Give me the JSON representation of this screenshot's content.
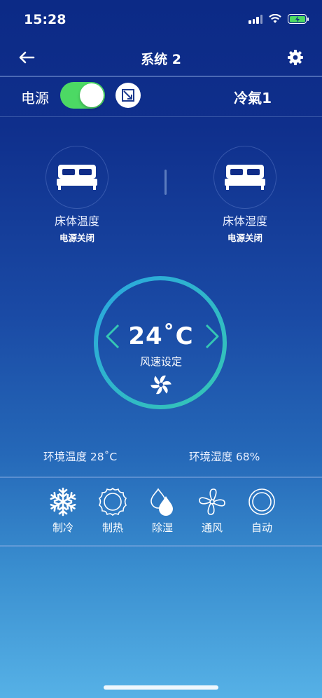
{
  "status_bar": {
    "time": "15:28"
  },
  "nav": {
    "title": "系统 2",
    "back_icon": "back-arrow-icon",
    "settings_icon": "gear-icon"
  },
  "power": {
    "label": "电源",
    "on": true,
    "accent": "#4cd964"
  },
  "room": {
    "name": "冷氣1"
  },
  "beds": [
    {
      "title": "床体温度",
      "status": "电源关闭",
      "icon": "bed-icon"
    },
    {
      "title": "床体湿度",
      "status": "电源关闭",
      "icon": "bed-icon"
    }
  ],
  "dial": {
    "temperature": "24˚C",
    "fan_label": "风速设定",
    "ring_colors": [
      "#2aa6e0",
      "#35c7b4"
    ]
  },
  "environment": {
    "temperature": "环境温度 28˚C",
    "humidity": "环境湿度 68%"
  },
  "modes": [
    {
      "label": "制冷",
      "icon": "snowflake-icon",
      "active": true
    },
    {
      "label": "制热",
      "icon": "sun-icon",
      "active": false
    },
    {
      "label": "除湿",
      "icon": "droplet-icon",
      "active": false
    },
    {
      "label": "通风",
      "icon": "fan-icon",
      "active": false
    },
    {
      "label": "自动",
      "icon": "auto-icon",
      "active": false
    }
  ]
}
